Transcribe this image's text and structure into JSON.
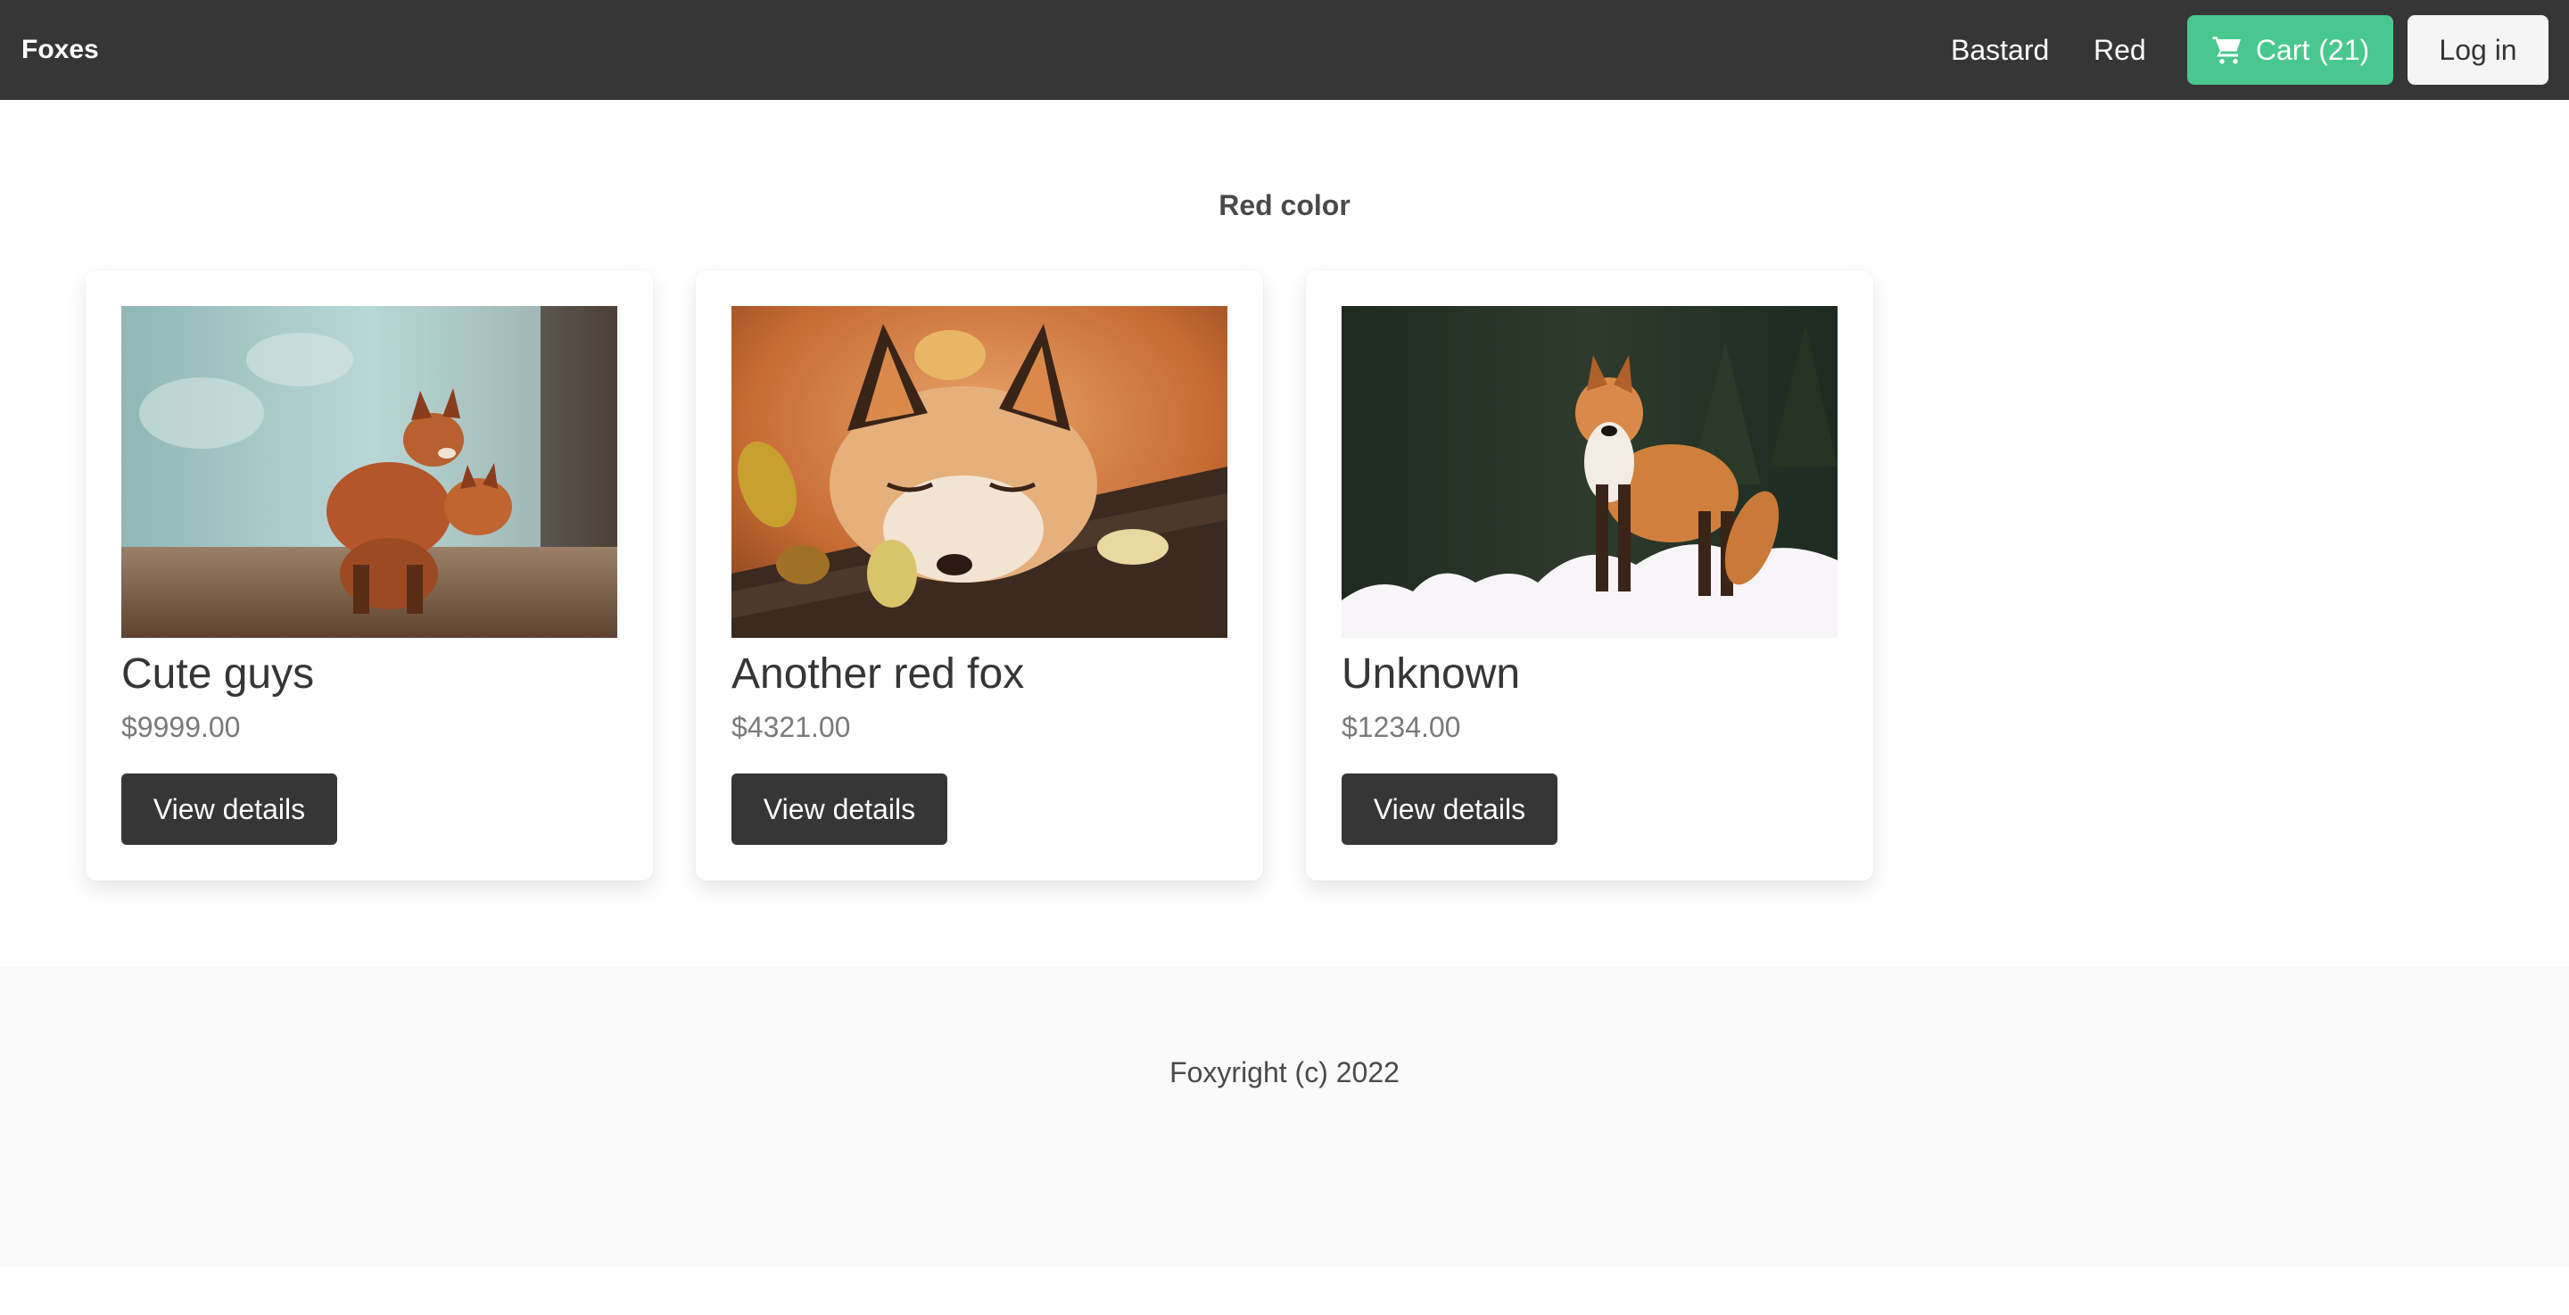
{
  "navbar": {
    "brand": "Foxes",
    "links": [
      {
        "label": "Bastard"
      },
      {
        "label": "Red"
      }
    ],
    "cart": {
      "label": "Cart",
      "count": "(21)",
      "icon": "shopping-cart-icon",
      "color": "#48c78e"
    },
    "login_label": "Log in",
    "background": "#363636"
  },
  "section": {
    "title": "Red color"
  },
  "products": [
    {
      "title": "Cute guys",
      "price": "$9999.00",
      "button": "View details",
      "image": "two-fox-cubs-photo"
    },
    {
      "title": "Another red fox",
      "price": "$4321.00",
      "button": "View details",
      "image": "sleeping-fox-autumn-leaves-photo"
    },
    {
      "title": "Unknown",
      "price": "$1234.00",
      "button": "View details",
      "image": "red-fox-standing-snow-photo"
    }
  ],
  "footer": {
    "text": "Foxyright (c) 2022"
  }
}
